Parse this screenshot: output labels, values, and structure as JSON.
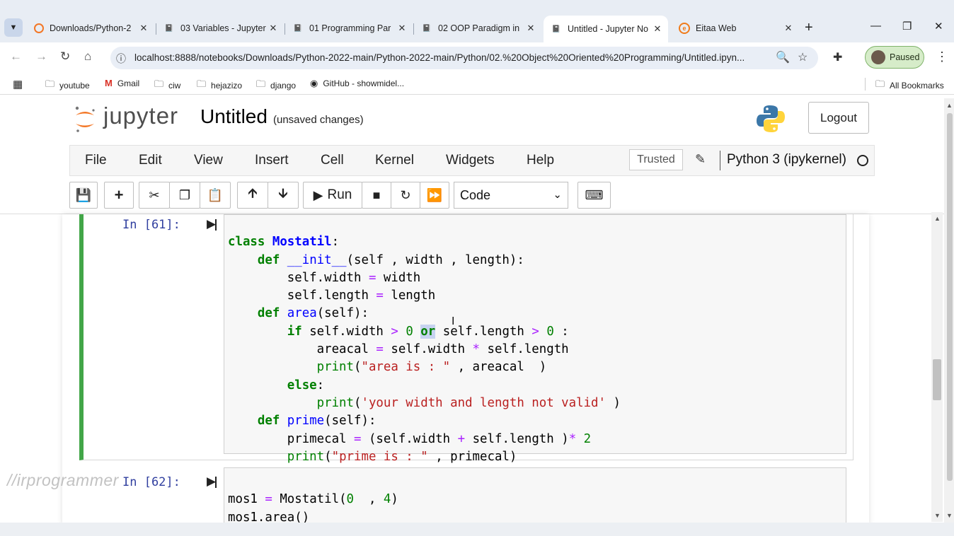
{
  "browser": {
    "tabs": [
      {
        "title": "Downloads/Python-2",
        "icon": "jupyter-icon"
      },
      {
        "title": "03 Variables - Jupyter",
        "icon": "notebook-icon"
      },
      {
        "title": "01 Programming Par",
        "icon": "notebook-icon"
      },
      {
        "title": "02 OOP Paradigm in",
        "icon": "notebook-icon"
      },
      {
        "title": "Untitled - Jupyter No",
        "icon": "notebook-icon",
        "active": true
      },
      {
        "title": "Eitaa Web",
        "icon": "eitaa-icon"
      }
    ],
    "url": "localhost:8888/notebooks/Downloads/Python-2022-main/Python-2022-main/Python/02.%20Object%20Oriented%20Programming/Untitled.ipyn...",
    "profile_status": "Paused",
    "bookmarks": [
      {
        "label": "youtube",
        "icon": "folder-icon"
      },
      {
        "label": "Gmail",
        "icon": "gmail-icon"
      },
      {
        "label": "ciw",
        "icon": "folder-icon"
      },
      {
        "label": "hejazizo",
        "icon": "folder-icon"
      },
      {
        "label": "django",
        "icon": "folder-icon"
      },
      {
        "label": "GitHub - showmidel...",
        "icon": "github-icon"
      }
    ],
    "all_bookmarks": "All Bookmarks"
  },
  "jupyter": {
    "logo_text": "jupyter",
    "notebook_title": "Untitled",
    "save_status": "(unsaved changes)",
    "logout_label": "Logout",
    "menu": [
      "File",
      "Edit",
      "View",
      "Insert",
      "Cell",
      "Kernel",
      "Widgets",
      "Help"
    ],
    "trusted_label": "Trusted",
    "kernel_name": "Python 3 (ipykernel)",
    "toolbar": {
      "run_label": "Run",
      "cell_type": "Code"
    }
  },
  "cells": [
    {
      "prompt": "In [61]:",
      "lines": [
        "class Mostatil:",
        "    def __init__(self , width , length):",
        "        self.width = width",
        "        self.length = length",
        "    def area(self):",
        "        if self.width > 0 or self.length > 0 :",
        "            areacal = self.width * self.length",
        "            print(\"area is : \" , areacal  )",
        "        else:",
        "            print('your width and length not valid' )",
        "    def prime(self):",
        "        primecal = (self.width + self.length )* 2",
        "        print(\"prime is : \" , primecal)"
      ]
    },
    {
      "prompt": "In [62]:",
      "lines": [
        "",
        "mos1 = Mostatil(0  , 4)",
        "mos1.area()"
      ]
    }
  ],
  "watermark": "//irprogrammer"
}
